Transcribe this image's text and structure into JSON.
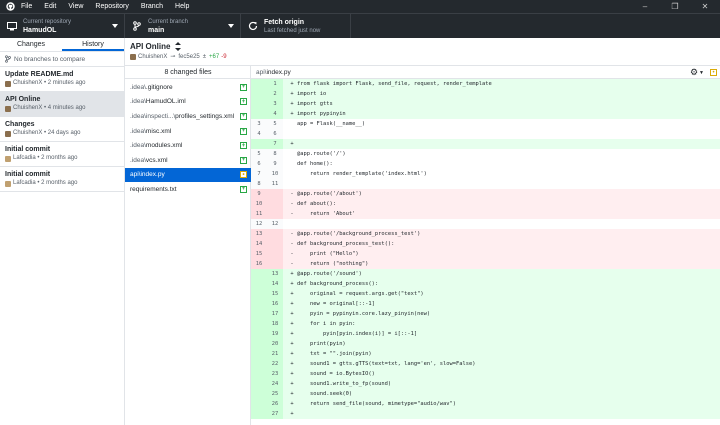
{
  "menu": {
    "items": [
      "File",
      "Edit",
      "View",
      "Repository",
      "Branch",
      "Help"
    ],
    "window_controls": [
      "–",
      "❐",
      "✕"
    ]
  },
  "toolbar": {
    "repo_label": "Current repository",
    "repo_value": "HamudOL",
    "branch_label": "Current branch",
    "branch_value": "main",
    "fetch_label": "Fetch origin",
    "fetch_sub": "Last fetched just now"
  },
  "left": {
    "tabs": [
      "Changes",
      "History"
    ],
    "compare_placeholder": "No branches to compare",
    "commits": [
      {
        "title": "Update README.md",
        "author": "ChuishenX",
        "time": "2 minutes ago"
      },
      {
        "title": "API Online",
        "author": "ChuishenX",
        "time": "4 minutes ago"
      },
      {
        "title": "Changes",
        "author": "ChuishenX",
        "time": "24 days ago"
      },
      {
        "title": "Initial commit",
        "author": "Lafcadia",
        "time": "2 months ago"
      },
      {
        "title": "Initial commit",
        "author": "Lafcadia",
        "time": "2 months ago"
      }
    ]
  },
  "commit": {
    "title": "API Online",
    "author": "ChuishenX",
    "sha": "fec5e25",
    "added": "+67",
    "removed": "-9",
    "files_count": "8 changed files"
  },
  "files": [
    {
      "dir": ".idea\\",
      "name": ".gitignore",
      "status": "+"
    },
    {
      "dir": ".idea\\",
      "name": "HamudOL.iml",
      "status": "+"
    },
    {
      "dir": ".idea\\inspecti...\\",
      "name": "profiles_settings.xml",
      "status": "+"
    },
    {
      "dir": ".idea\\",
      "name": "misc.xml",
      "status": "+"
    },
    {
      "dir": ".idea\\",
      "name": "modules.xml",
      "status": "+"
    },
    {
      "dir": ".idea\\",
      "name": "vcs.xml",
      "status": "+"
    },
    {
      "dir": "api\\",
      "name": "index.py",
      "status": "•"
    },
    {
      "dir": "",
      "name": "requirements.txt",
      "status": "+"
    }
  ],
  "diff": {
    "path_dir": "api\\",
    "path_file": "index.py",
    "lines": [
      {
        "t": "add",
        "o": "",
        "n": "1",
        "m": "+",
        "c": "from flask import Flask, send_file, request, render_template"
      },
      {
        "t": "add",
        "o": "",
        "n": "2",
        "m": "+",
        "c": "import io"
      },
      {
        "t": "add",
        "o": "",
        "n": "3",
        "m": "+",
        "c": "import gtts"
      },
      {
        "t": "add",
        "o": "",
        "n": "4",
        "m": "+",
        "c": "import pypinyin"
      },
      {
        "t": "ctx",
        "o": "3",
        "n": "5",
        "m": "",
        "c": "app = Flask(__name__)"
      },
      {
        "t": "ctx",
        "o": "4",
        "n": "6",
        "m": "",
        "c": ""
      },
      {
        "t": "add",
        "o": "",
        "n": "7",
        "m": "+",
        "c": ""
      },
      {
        "t": "ctx",
        "o": "5",
        "n": "8",
        "m": "",
        "c": "@app.route('/')"
      },
      {
        "t": "ctx",
        "o": "6",
        "n": "9",
        "m": "",
        "c": "def home():"
      },
      {
        "t": "ctx",
        "o": "7",
        "n": "10",
        "m": "",
        "c": "    return render_template('index.html')"
      },
      {
        "t": "ctx",
        "o": "8",
        "n": "11",
        "m": "",
        "c": ""
      },
      {
        "t": "del",
        "o": "9",
        "n": "",
        "m": "-",
        "c": "@app.route('/about')"
      },
      {
        "t": "del",
        "o": "10",
        "n": "",
        "m": "-",
        "c": "def about():"
      },
      {
        "t": "del",
        "o": "11",
        "n": "",
        "m": "-",
        "c": "    return 'About'"
      },
      {
        "t": "ctx",
        "o": "12",
        "n": "12",
        "m": "",
        "c": ""
      },
      {
        "t": "del",
        "o": "13",
        "n": "",
        "m": "-",
        "c": "@app.route('/background_process_test')"
      },
      {
        "t": "del",
        "o": "14",
        "n": "",
        "m": "-",
        "c": "def background_process_test():"
      },
      {
        "t": "del",
        "o": "15",
        "n": "",
        "m": "-",
        "c": "    print (\"Hello\")"
      },
      {
        "t": "del",
        "o": "16",
        "n": "",
        "m": "-",
        "c": "    return (\"nothing\")"
      },
      {
        "t": "add",
        "o": "",
        "n": "13",
        "m": "+",
        "c": "@app.route('/sound')"
      },
      {
        "t": "add",
        "o": "",
        "n": "14",
        "m": "+",
        "c": "def background_process():"
      },
      {
        "t": "add",
        "o": "",
        "n": "15",
        "m": "+",
        "c": "    original = request.args.get(\"text\")"
      },
      {
        "t": "add",
        "o": "",
        "n": "16",
        "m": "+",
        "c": "    new = original[::-1]"
      },
      {
        "t": "add",
        "o": "",
        "n": "17",
        "m": "+",
        "c": "    pyin = pypinyin.core.lazy_pinyin(new)"
      },
      {
        "t": "add",
        "o": "",
        "n": "18",
        "m": "+",
        "c": "    for i in pyin:"
      },
      {
        "t": "add",
        "o": "",
        "n": "19",
        "m": "+",
        "c": "        pyin[pyin.index(i)] = i[::-1]"
      },
      {
        "t": "add",
        "o": "",
        "n": "20",
        "m": "+",
        "c": "    print(pyin)"
      },
      {
        "t": "add",
        "o": "",
        "n": "21",
        "m": "+",
        "c": "    txt = \"\".join(pyin)"
      },
      {
        "t": "add",
        "o": "",
        "n": "22",
        "m": "+",
        "c": "    sound1 = gtts.gTTS(text=txt, lang='en', slow=False)"
      },
      {
        "t": "add",
        "o": "",
        "n": "23",
        "m": "+",
        "c": "    sound = io.BytesIO()"
      },
      {
        "t": "add",
        "o": "",
        "n": "24",
        "m": "+",
        "c": "    sound1.write_to_fp(sound)"
      },
      {
        "t": "add",
        "o": "",
        "n": "25",
        "m": "+",
        "c": "    sound.seek(0)"
      },
      {
        "t": "add",
        "o": "",
        "n": "26",
        "m": "+",
        "c": "    return send_file(sound, mimetype=\"audio/wav\")"
      },
      {
        "t": "add",
        "o": "",
        "n": "27",
        "m": "+",
        "c": ""
      }
    ]
  },
  "colors": {
    "toolbar_bg": "#24292e",
    "accent": "#0366d6",
    "added": "#28a745",
    "removed": "#cb2431",
    "modified": "#dbab09"
  }
}
